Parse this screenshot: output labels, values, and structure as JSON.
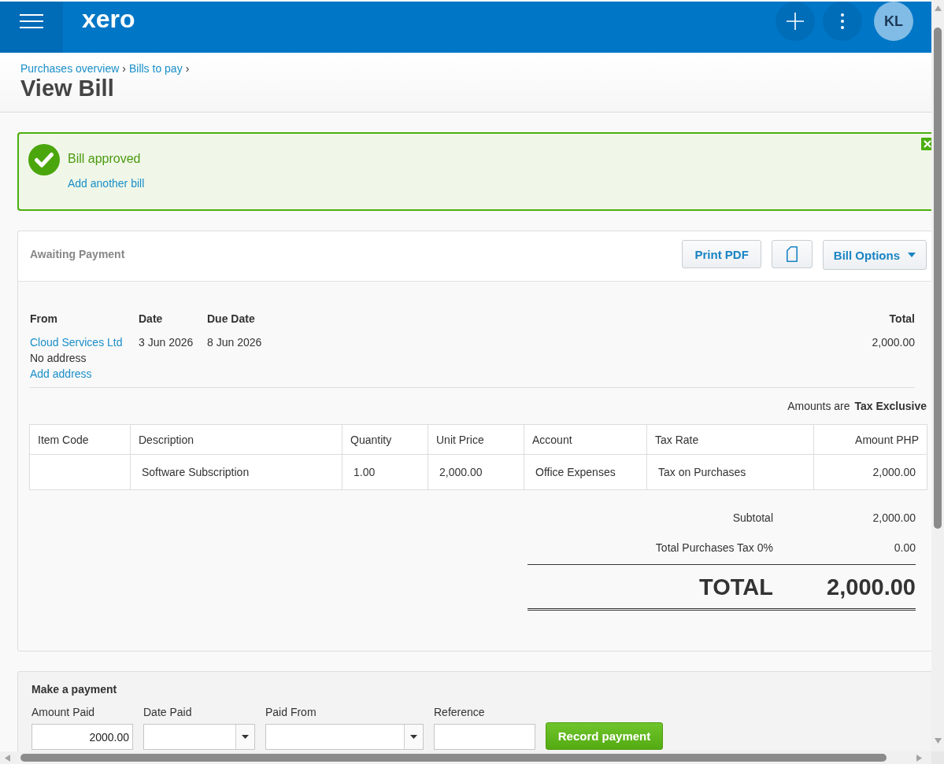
{
  "top_bar": {
    "logo": "xero",
    "avatar": "KL"
  },
  "breadcrumbs": [
    {
      "label": "Purchases overview",
      "separator": "›"
    },
    {
      "label": "Bills to pay",
      "separator": "›"
    }
  ],
  "page_title": "View Bill",
  "notification": {
    "message": "Bill approved",
    "link": "Add another bill"
  },
  "bill": {
    "status": "Awaiting Payment",
    "buttons": [
      {
        "kind": "text",
        "label": "Print PDF"
      },
      {
        "kind": "icon"
      },
      {
        "kind": "dropdown",
        "label": "Bill Options"
      }
    ],
    "from": {
      "heading": "From",
      "contact": "Cloud Services Ltd",
      "address": "No address",
      "address_link": "Add address"
    },
    "date": {
      "heading": "Date",
      "value": "3 Jun 2026"
    },
    "due_date": {
      "heading": "Due Date",
      "value": "8 Jun 2026"
    },
    "total": {
      "heading": "Total",
      "value": "2,000.00"
    },
    "amounts_note": "Amounts are **Tax Exclusive**",
    "line_items": {
      "columns": [
        "Item Code",
        "Description",
        "Quantity",
        "Unit Price",
        "Account",
        "Tax Rate",
        "Amount PHP"
      ],
      "rows": [
        {
          "description": "Software Subscription",
          "quantity": "1.00",
          "unit_price": "2,000.00",
          "account": "Office Expenses",
          "tax_rate": "Tax on Purchases",
          "amount": "2,000.00"
        }
      ]
    },
    "totals": [
      {
        "label": "Subtotal",
        "value": "2,000.00"
      },
      {
        "label": "Total Purchases Tax 0%",
        "value": "0.00"
      }
    ],
    "grand_total": {
      "label": "TOTAL",
      "value": "2,000.00"
    }
  },
  "payment": {
    "title": "Make a payment",
    "fields": [
      {
        "kind": "text",
        "label": "Amount Paid",
        "value": "2000.00"
      },
      {
        "kind": "select",
        "label": "Date Paid"
      },
      {
        "kind": "select",
        "label": "Paid From"
      },
      {
        "kind": "text",
        "label": "Reference"
      }
    ],
    "button": "Record payment"
  }
}
